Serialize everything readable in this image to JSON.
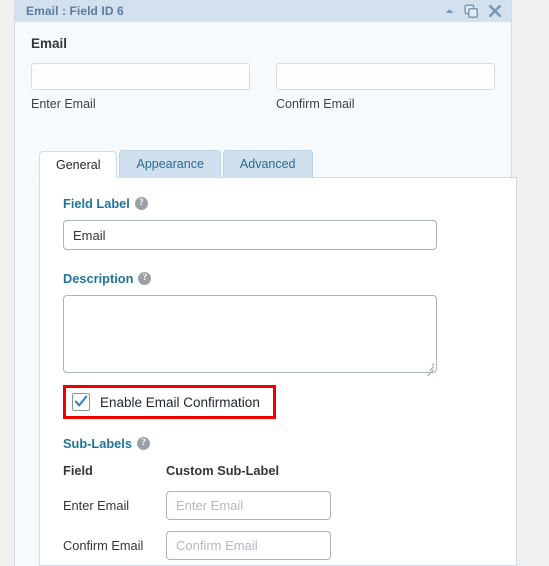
{
  "titlebar": {
    "title": "Email : Field ID 6",
    "icons": {
      "collapse": "caret-up-icon",
      "duplicate": "duplicate-icon",
      "close": "close-icon"
    }
  },
  "preview": {
    "label": "Email",
    "enter_sublabel": "Enter Email",
    "confirm_sublabel": "Confirm Email"
  },
  "tabs": [
    {
      "label": "General",
      "active": true
    },
    {
      "label": "Appearance",
      "active": false
    },
    {
      "label": "Advanced",
      "active": false
    }
  ],
  "general": {
    "field_label": {
      "label": "Field Label",
      "help": "?",
      "value": "Email",
      "placeholder": ""
    },
    "description": {
      "label": "Description",
      "help": "?",
      "value": "",
      "placeholder": ""
    },
    "email_confirmation": {
      "label": "Enable Email Confirmation",
      "checked": true,
      "highlight_color": "#ee0000"
    },
    "sub_labels": {
      "label": "Sub-Labels",
      "help": "?",
      "columns": [
        "Field",
        "Custom Sub-Label"
      ],
      "rows": [
        {
          "field": "Enter Email",
          "value": "",
          "placeholder": "Enter Email"
        },
        {
          "field": "Confirm Email",
          "value": "",
          "placeholder": "Confirm Email"
        }
      ]
    }
  },
  "colors": {
    "titlebar_bg": "#d3e0ed",
    "titlebar_text": "#5b7c9d",
    "panel_bg": "#f6fafd",
    "label_blue": "#21759b",
    "tab_inactive_bg": "#cfe0ee",
    "accent_red": "#ee0000",
    "checkmark_blue": "#2e86c8"
  }
}
